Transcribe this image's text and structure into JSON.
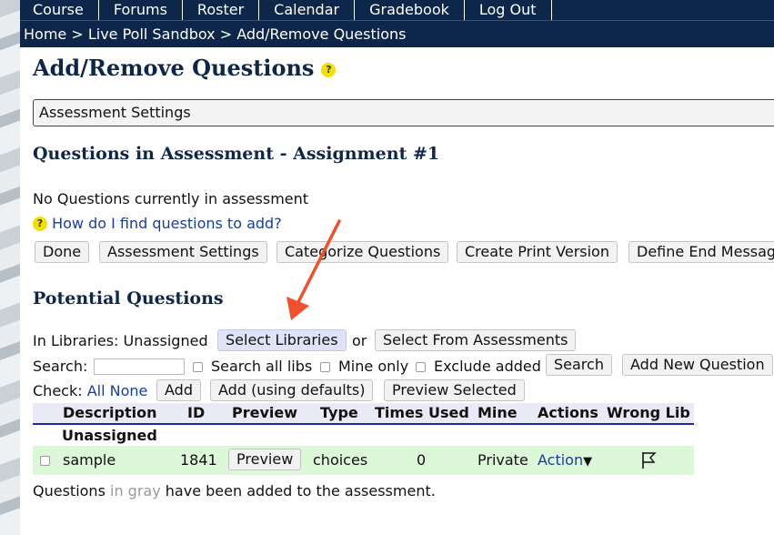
{
  "nav": {
    "tabs": [
      "Course",
      "Forums",
      "Roster",
      "Calendar",
      "Gradebook",
      "Log Out"
    ]
  },
  "breadcrumb": "Home > Live Poll Sandbox > Add/Remove Questions",
  "page_title": "Add/Remove Questions",
  "help_glyph": "?",
  "assessment_settings_box": "Assessment Settings",
  "questions_in_assessment": {
    "heading": "Questions in Assessment - Assignment #1",
    "empty_text": "No Questions currently in assessment",
    "help_link": "How do I find questions to add?",
    "buttons": {
      "done": "Done",
      "assessment_settings": "Assessment Settings",
      "categorize": "Categorize Questions",
      "print": "Create Print Version",
      "end_message": "Define End Messag"
    }
  },
  "potential": {
    "heading": "Potential Questions",
    "libraries_label": "In Libraries: Unassigned",
    "select_libraries": "Select Libraries",
    "or": "or",
    "select_from_assessments": "Select From Assessments",
    "search_label": "Search:",
    "search_value": "",
    "search_all_libs": "Search all libs",
    "mine_only": "Mine only",
    "exclude_added": "Exclude added",
    "search_button": "Search",
    "add_new_question": "Add New Question",
    "check_label": "Check:",
    "check_all": "All",
    "check_none": "None",
    "add": "Add",
    "add_defaults": "Add (using defaults)",
    "preview_selected": "Preview Selected"
  },
  "table": {
    "columns": [
      "Description",
      "ID",
      "Preview",
      "Type",
      "Times Used",
      "Mine",
      "Actions",
      "Wrong Lib"
    ],
    "group": "Unassigned",
    "rows": [
      {
        "description": "sample",
        "id": "1841",
        "preview": "Preview",
        "type": "choices",
        "times_used": "0",
        "mine": "Private",
        "action": "Action",
        "action_caret": "▼"
      }
    ]
  },
  "footer": {
    "prefix": "Questions",
    "gray": "in gray",
    "suffix": "have been added to the assessment."
  },
  "colors": {
    "nav_bg": "#0d2649",
    "heading": "#0d2649",
    "link": "#1a3d9a",
    "row_bg": "#ddf7d9",
    "arrow": "#f0502a",
    "help": "#f2e100"
  }
}
